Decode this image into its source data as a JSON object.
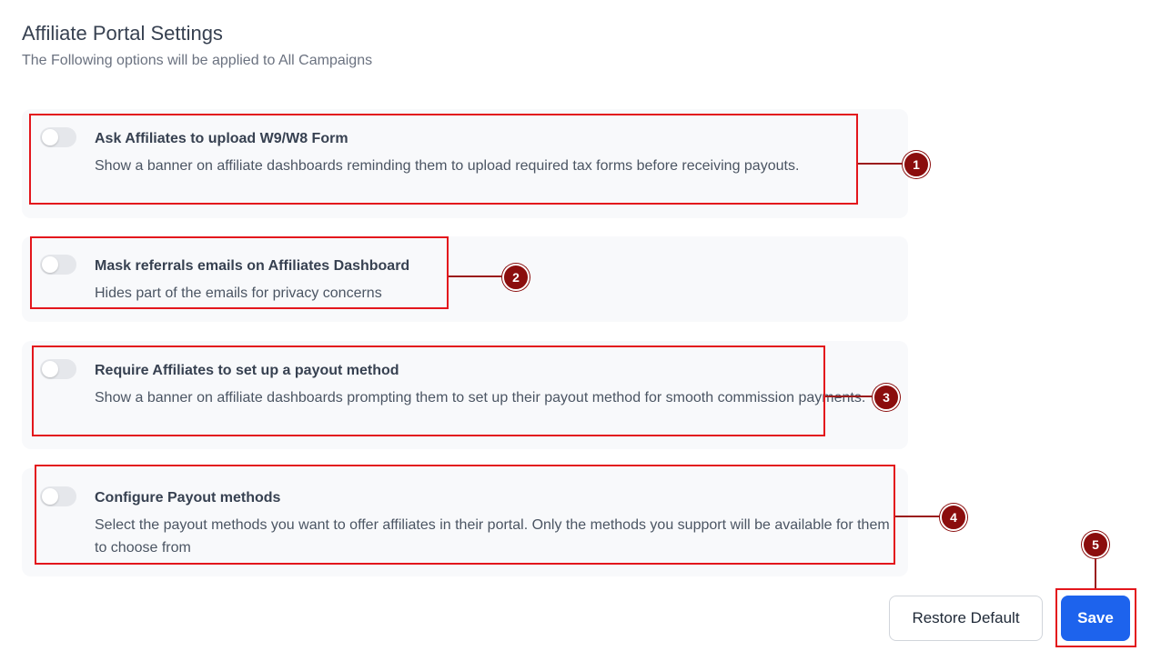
{
  "header": {
    "title": "Affiliate Portal Settings",
    "subtitle": "The Following options will be applied to All Campaigns"
  },
  "settings": [
    {
      "title": "Ask Affiliates to upload W9/W8 Form",
      "description": "Show a banner on affiliate dashboards reminding them to upload required tax forms before receiving payouts.",
      "enabled": false
    },
    {
      "title": "Mask referrals emails on Affiliates Dashboard",
      "description": "Hides part of the emails for privacy concerns",
      "enabled": false
    },
    {
      "title": "Require Affiliates to set up a payout method",
      "description": "Show a banner on affiliate dashboards prompting them to set up their payout method for smooth commission payments.",
      "enabled": false
    },
    {
      "title": "Configure Payout methods",
      "description": "Select the payout methods you want to offer affiliates in their portal. Only the methods you support will be available for them to choose from",
      "enabled": false
    }
  ],
  "annotations": [
    "1",
    "2",
    "3",
    "4",
    "5"
  ],
  "actions": {
    "restore_label": "Restore Default",
    "save_label": "Save"
  },
  "colors": {
    "accent": "#1d63ed",
    "highlight": "#e3161c",
    "badge": "#8b0d0d",
    "card_bg": "#f8f9fb"
  }
}
